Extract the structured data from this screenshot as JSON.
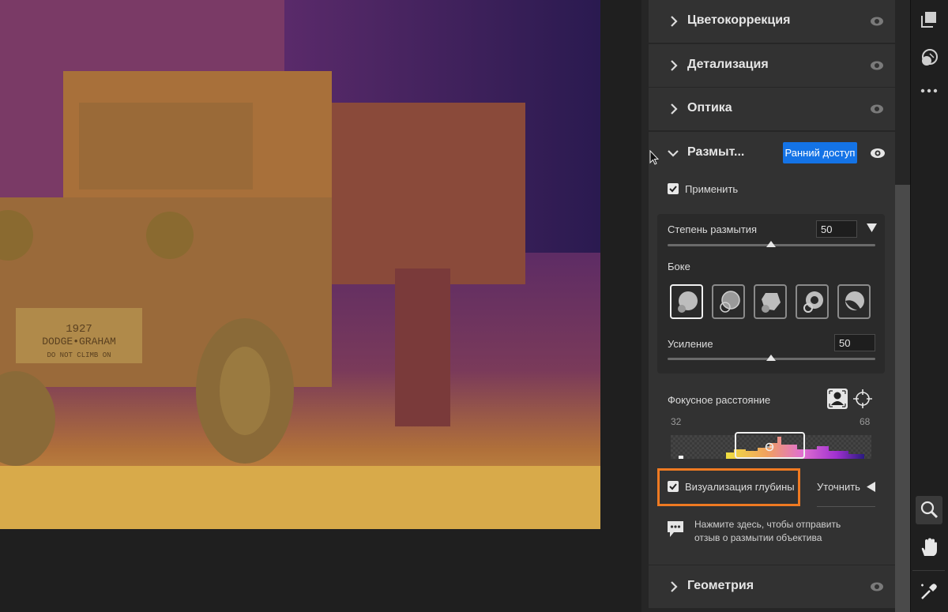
{
  "sections": {
    "color_correction": "Цветокоррекция",
    "detail": "Детализация",
    "optics": "Оптика",
    "blur": "Размыт...",
    "geometry": "Геометрия"
  },
  "blur": {
    "early_access_badge": "Ранний доступ",
    "apply_label": "Применить",
    "apply_checked": true,
    "blur_amount_label": "Степень размытия",
    "blur_amount_value": "50",
    "bokeh_label": "Боке",
    "bokeh_options": [
      "circle",
      "bubble",
      "blade",
      "ring",
      "cat-eye"
    ],
    "bokeh_selected": 0,
    "boost_label": "Усиление",
    "boost_value": "50",
    "focal_range_label": "Фокусное расстояние",
    "focal_min": "32",
    "focal_max": "68",
    "depth_viz_label": "Визуализация глубины",
    "depth_viz_checked": true,
    "refine_label": "Уточнить",
    "feedback_text": "Нажмите здесь, чтобы отправить отзыв о размытии объектива"
  },
  "photo": {
    "plate_line1": "1927",
    "plate_line2": "DODGE•GRAHAM",
    "plate_line3": "DO NOT CLIMB ON"
  },
  "colors": {
    "accent": "#1473e6",
    "highlight": "#ef7a22",
    "panel": "#323232"
  },
  "icons": {
    "right_toolbar": [
      "layers-icon",
      "presets-icon",
      "more-icon",
      "zoom-icon",
      "hand-icon",
      "sampler-icon"
    ]
  }
}
